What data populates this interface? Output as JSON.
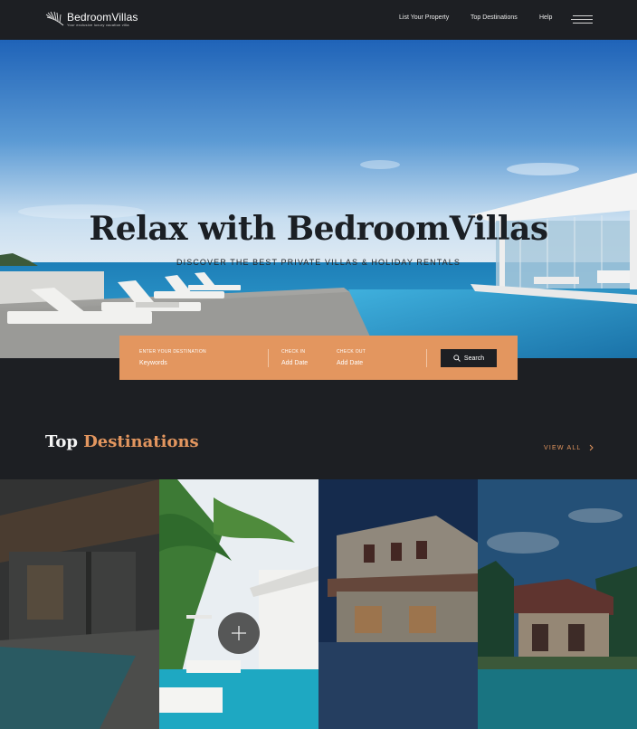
{
  "brand": {
    "name": "BedroomVillas",
    "tagline": "Your exclusive luxury vacation villa"
  },
  "nav": {
    "items": [
      "List Your Property",
      "Top Destinations",
      "Help"
    ]
  },
  "hero": {
    "title": "Relax with BedroomVillas",
    "subtitle": "DISCOVER THE BEST PRIVATE VILLAS & HOLIDAY RENTALS"
  },
  "search": {
    "destination_label": "ENTER YOUR DESTINATION",
    "destination_placeholder": "Keywords",
    "checkin_label": "CHECK IN",
    "checkin_value": "Add Date",
    "checkout_label": "CHECK OUT",
    "checkout_value": "Add Date",
    "button_label": "Search"
  },
  "destinations": {
    "title_part1": "Top ",
    "title_part2": "Destinations",
    "view_all": "VIEW ALL"
  },
  "colors": {
    "accent": "#e3965f",
    "background": "#1d1f23"
  }
}
